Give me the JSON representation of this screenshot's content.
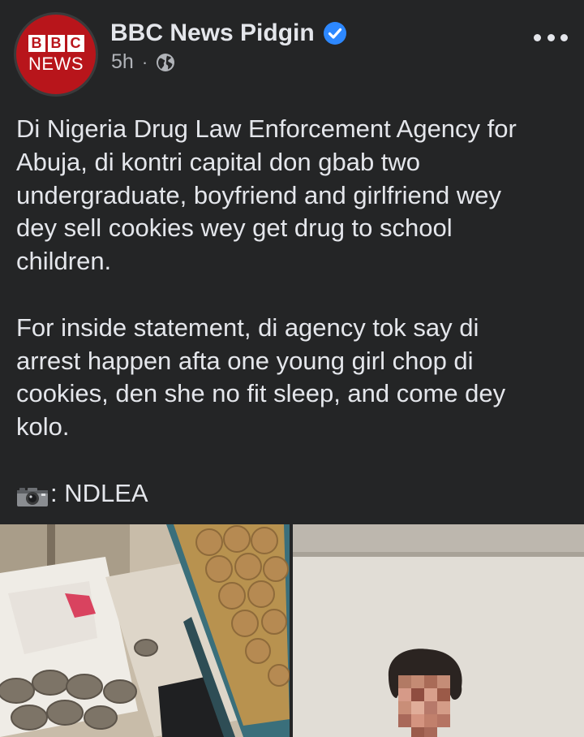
{
  "post": {
    "page_name": "BBC News Pidgin",
    "avatar": {
      "top_text": "BBC",
      "bottom_text": "NEWS"
    },
    "timestamp": "5h",
    "separator": "·",
    "audience_icon": "globe-icon",
    "verified_icon": "verified-badge-icon",
    "more_icon": "more-options-icon",
    "body": {
      "lines_p1": [
        "Di Nigeria Drug Law Enforcement Agency for",
        "Abuja, di kontri capital don gbab two",
        "undergraduate, boyfriend and girlfriend wey",
        "dey sell cookies wey get drug to school",
        "children."
      ],
      "lines_p2": [
        "For inside statement, di agency tok say di",
        "arrest happen afta one young girl chop di",
        "cookies, den she no fit sleep, and come dey",
        "kolo."
      ],
      "credit_icon": "camera-icon",
      "credit_text": ": NDLEA"
    },
    "colors": {
      "background": "#242526",
      "text": "#e4e6eb",
      "secondary_text": "#b0b3b8",
      "verified": "#2d88ff",
      "bbc_red": "#b8151b"
    }
  }
}
